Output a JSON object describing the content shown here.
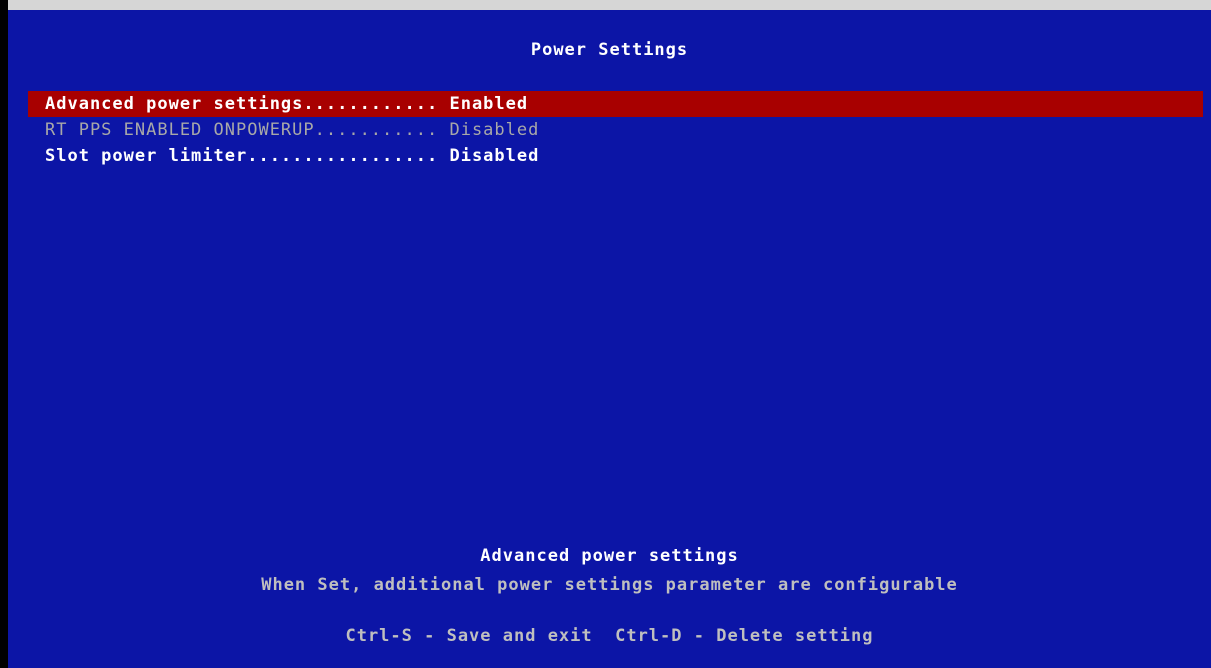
{
  "title": "Power Settings",
  "menu": {
    "items": [
      {
        "label": "Advanced power settings............ ",
        "value": "Enabled"
      },
      {
        "label": "RT PPS ENABLED ONPOWERUP........... ",
        "value": "Disabled"
      },
      {
        "label": "Slot power limiter................. ",
        "value": "Disabled"
      }
    ],
    "selected_index": 0
  },
  "help": {
    "title": "Advanced power settings",
    "text": "When Set, additional power settings parameter are configurable"
  },
  "footer": {
    "text": "Ctrl-S - Save and exit  Ctrl-D - Delete setting"
  },
  "colors": {
    "background": "#0c15a6",
    "selection": "#a80000",
    "text": "#ffffff",
    "disabled_text": "#a8a8a8",
    "help_text": "#bfbfbf"
  }
}
